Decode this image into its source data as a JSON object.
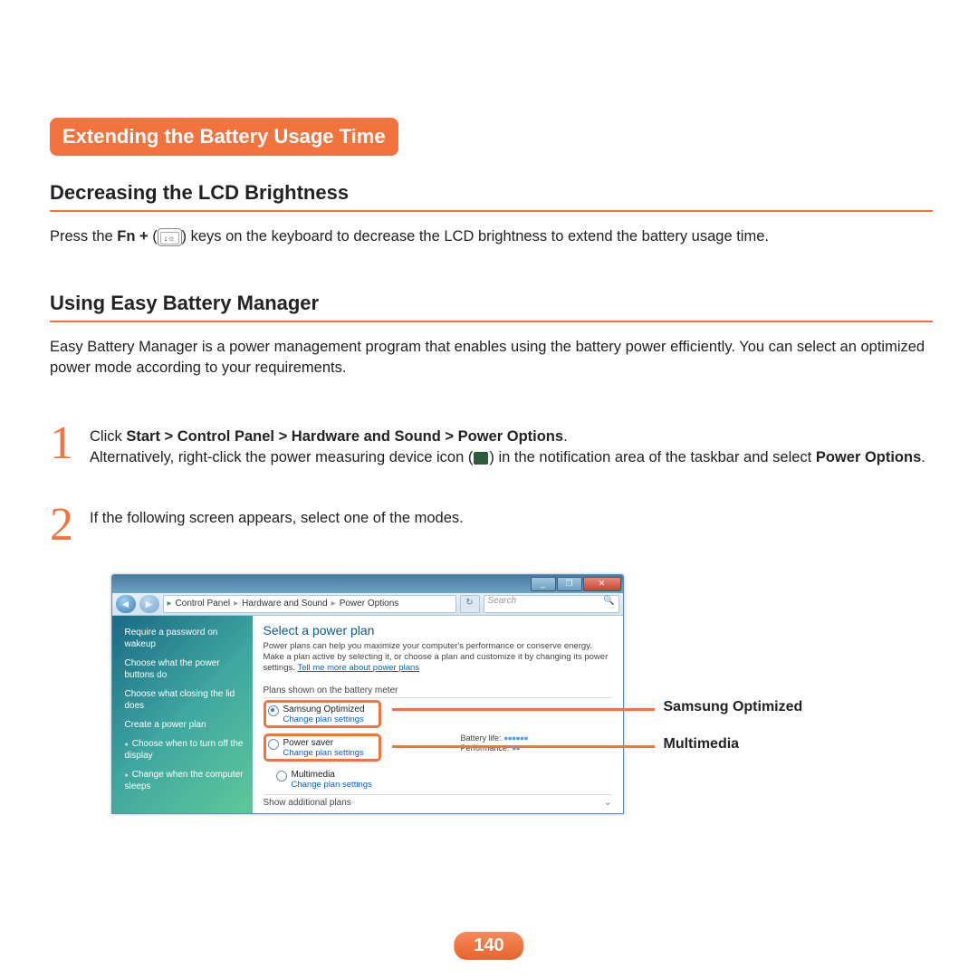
{
  "title": "Extending the Battery Usage Time",
  "section1": {
    "heading": "Decreasing the LCD Brightness",
    "body_a": "Press the ",
    "fn": "Fn + ",
    "body_b": " keys on the keyboard to decrease the LCD brightness to extend the battery usage time.",
    "key_symbol": "↓☼"
  },
  "section2": {
    "heading": "Using Easy Battery Manager",
    "body": "Easy Battery Manager is a power management program that enables using the battery power efficiently. You can select an optimized power mode according to your requirements."
  },
  "step1": {
    "num": "1",
    "a": "Click ",
    "path": "Start > Control Panel > Hardware and Sound > Power Options",
    "b": ".",
    "c": "Alternatively, right-click the power measuring device icon (",
    "d": ") in the notification area of the taskbar and select ",
    "po": "Power Options",
    "e": "."
  },
  "step2": {
    "num": "2",
    "text": "If the following screen appears, select one of the modes."
  },
  "window": {
    "breadcrumb": [
      "Control Panel",
      "Hardware and Sound",
      "Power Options"
    ],
    "search_placeholder": "Search",
    "sidebar_links": [
      "Require a password on wakeup",
      "Choose what the power buttons do",
      "Choose what closing the lid does",
      "Create a power plan",
      "Choose when to turn off the display",
      "Change when the computer sleeps"
    ],
    "panel_heading": "Select a power plan",
    "panel_sub_a": "Power plans can help you maximize your computer's performance or conserve energy. Make a plan active by selecting it, or choose a plan and customize it by changing its power settings. ",
    "panel_link1": "Tell me more about power plans",
    "plans_label": "Plans shown on the battery meter",
    "plan1": {
      "name": "Samsung Optimized",
      "change": "Change plan settings"
    },
    "plan2": {
      "name": "Power saver",
      "change": "Change plan settings"
    },
    "plan3": {
      "name": "Multimedia",
      "change": "Change plan settings"
    },
    "battery_label": "Battery life:",
    "perf_label": "Performance:",
    "show_additional": "Show additional plans"
  },
  "callouts": {
    "c1": "Samsung Optimized",
    "c2": "Multimedia"
  },
  "page_number": "140"
}
